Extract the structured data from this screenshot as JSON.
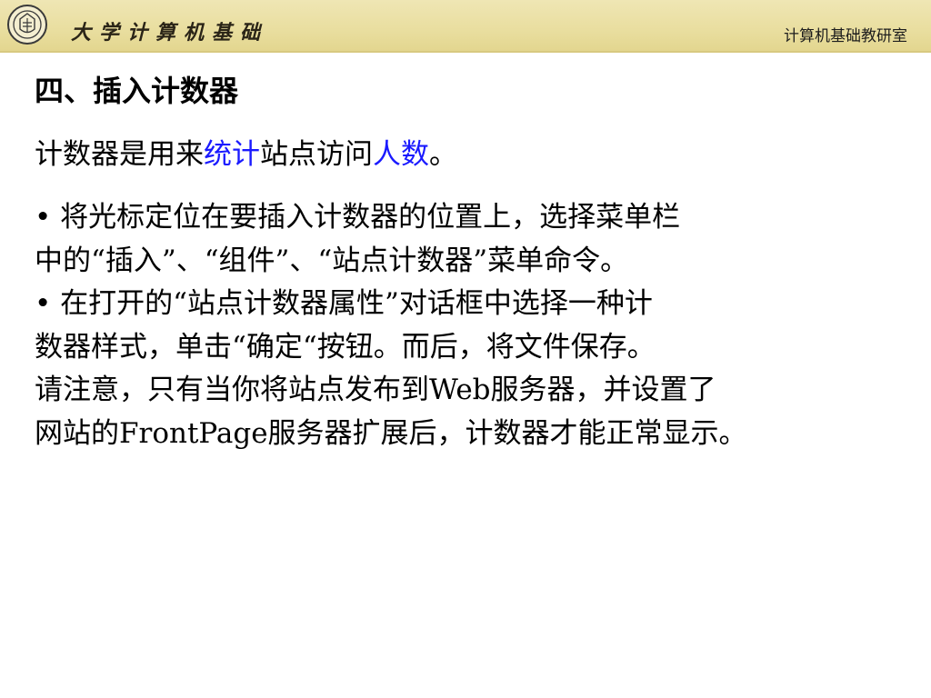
{
  "header": {
    "brand_text": "大学计算机基础",
    "department": "计算机基础教研室"
  },
  "slide": {
    "heading": "四、插入计数器",
    "intro": {
      "part1": "计数器是用来",
      "highlight1": "统计",
      "part2": "站点访问",
      "highlight2": "人数",
      "part3": "。"
    },
    "lines": [
      "• 将光标定位在要插入计数器的位置上，选择菜单栏",
      "中的“插入”、“组件”、“站点计数器”菜单命令。",
      "• 在打开的“站点计数器属性”对话框中选择一种计",
      "数器样式，单击“确定“按钮。而后，将文件保存。",
      "请注意，只有当你将站点发布到Web服务器，并设置了",
      "网站的FrontPage服务器扩展后，计数器才能正常显示。"
    ]
  },
  "colors": {
    "banner": "#e9de9f",
    "highlight": "#1a1aff"
  }
}
